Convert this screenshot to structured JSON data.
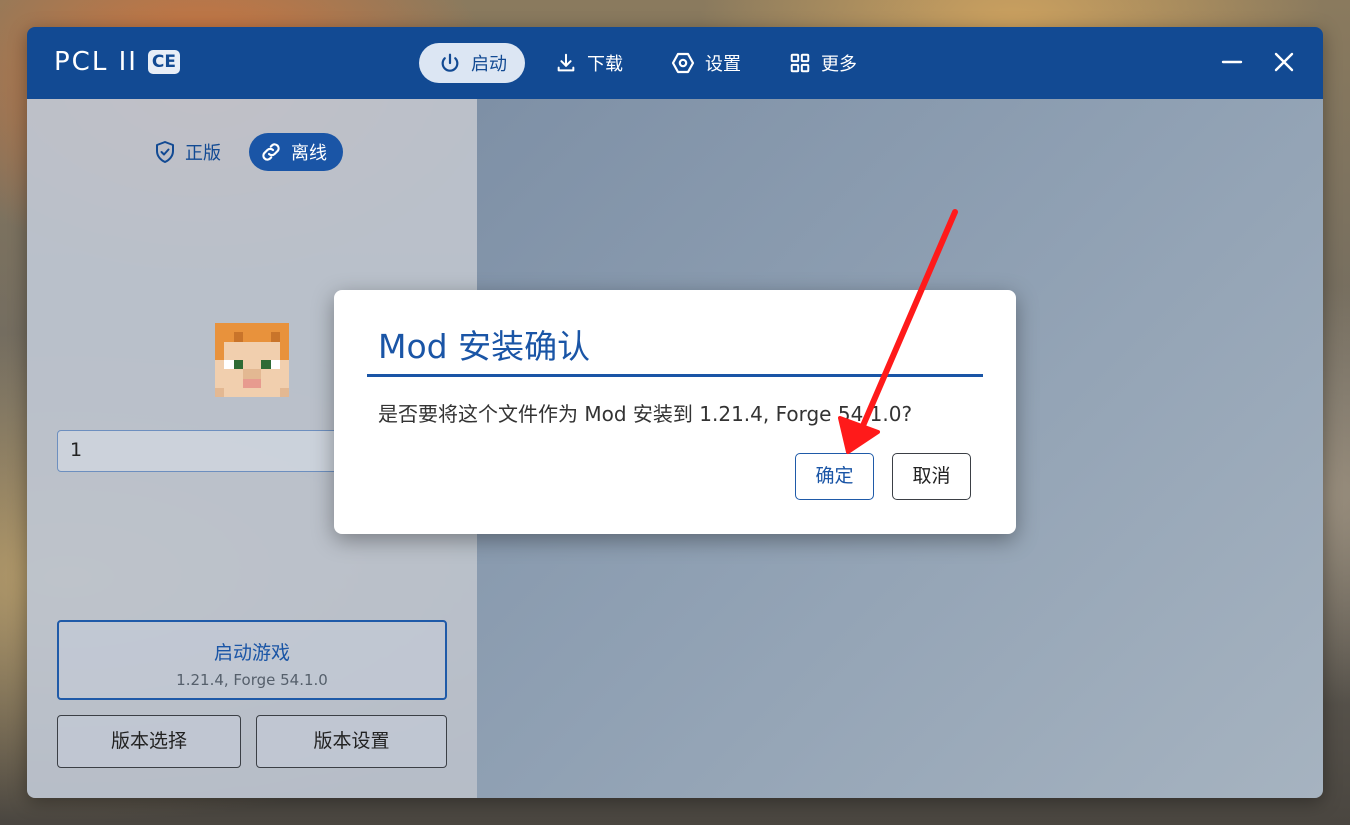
{
  "app": {
    "logo_text": "PCL II",
    "logo_badge": "CE"
  },
  "nav": [
    {
      "label": "启动",
      "icon": "power-icon",
      "active": true
    },
    {
      "label": "下载",
      "icon": "download-icon",
      "active": false
    },
    {
      "label": "设置",
      "icon": "settings-hexagon-icon",
      "active": false
    },
    {
      "label": "更多",
      "icon": "grid-icon",
      "active": false
    }
  ],
  "auth": {
    "tabs": [
      {
        "label": "正版",
        "icon": "shield-check-icon"
      },
      {
        "label": "离线",
        "icon": "link-icon",
        "active": true
      }
    ]
  },
  "sidebar": {
    "username_value": "1",
    "launch_button": {
      "title": "启动游戏",
      "subtitle": "1.21.4, Forge 54.1.0"
    },
    "version_select_label": "版本选择",
    "version_settings_label": "版本设置"
  },
  "dialog": {
    "title": "Mod 安装确认",
    "message": "是否要将这个文件作为 Mod 安装到 1.21.4, Forge 54.1.0?",
    "ok_label": "确定",
    "cancel_label": "取消"
  },
  "colors": {
    "accent": "#124a93",
    "annotation_arrow": "#ff1a1a"
  }
}
